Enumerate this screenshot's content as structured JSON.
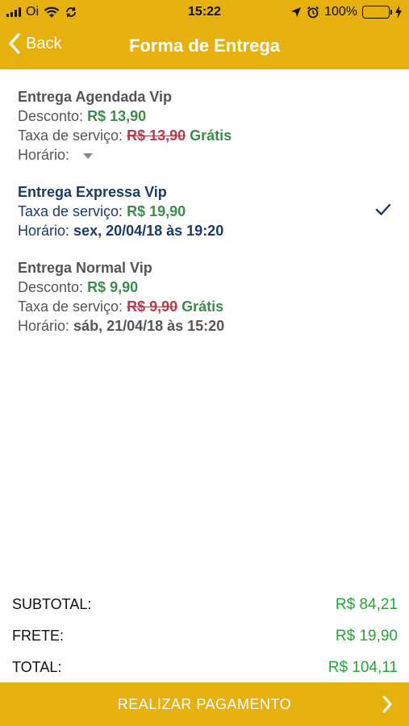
{
  "status_bar": {
    "carrier": "Oi",
    "time": "15:22",
    "battery": "100%"
  },
  "nav": {
    "back_label": "Back",
    "title": "Forma de Entrega"
  },
  "options": [
    {
      "name": "Entrega Agendada Vip",
      "discount_label": "Desconto:",
      "discount_value": "R$ 13,90",
      "fee_label": "Taxa de serviço:",
      "fee_old": "R$ 13,90",
      "fee_new": "Grátis",
      "schedule_label": "Horário:"
    },
    {
      "name": "Entrega Expressa Vip",
      "fee_label": "Taxa de serviço:",
      "fee_value": "R$ 19,90",
      "schedule_label": "Horário:",
      "schedule_value": "sex, 20/04/18 às 19:20",
      "selected": true
    },
    {
      "name": "Entrega Normal Vip",
      "discount_label": "Desconto:",
      "discount_value": "R$ 9,90",
      "fee_label": "Taxa de serviço:",
      "fee_old": "R$ 9,90",
      "fee_new": "Grátis",
      "schedule_label": "Horário:",
      "schedule_value": "sáb, 21/04/18 às 15:20"
    }
  ],
  "totals": {
    "subtotal_label": "SUBTOTAL:",
    "subtotal_value": "R$ 84,21",
    "shipping_label": "FRETE:",
    "shipping_value": "R$ 19,90",
    "total_label": "TOTAL:",
    "total_value": "R$ 104,11"
  },
  "pay_button": {
    "label": "REALIZAR PAGAMENTO"
  },
  "colors": {
    "brand": "#e6b10e",
    "selected_text": "#1c3a66",
    "green": "#3c8c4b",
    "total_green": "#22a832",
    "strike_red": "#b83a4d"
  }
}
